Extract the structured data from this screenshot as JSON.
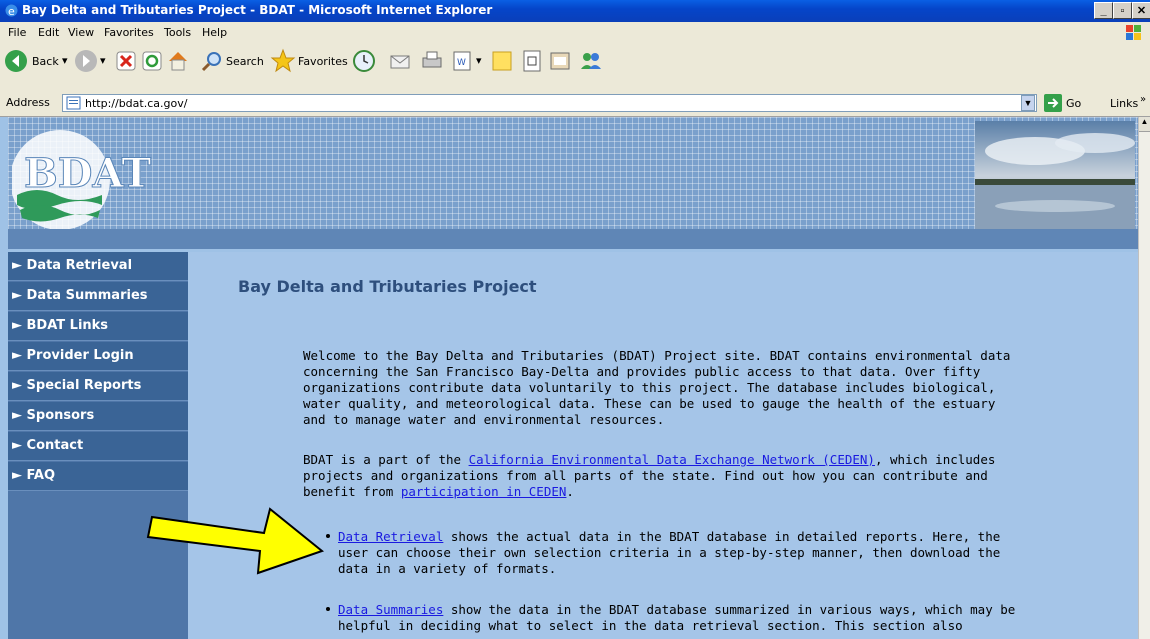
{
  "window": {
    "title": "Bay Delta and Tributaries Project - BDAT - Microsoft Internet Explorer"
  },
  "menu": [
    "File",
    "Edit",
    "View",
    "Favorites",
    "Tools",
    "Help"
  ],
  "toolbar": {
    "back_label": "Back",
    "search_label": "Search",
    "favorites_label": "Favorites"
  },
  "address": {
    "label": "Address",
    "url": "http://bdat.ca.gov/",
    "go_label": "Go",
    "links_label": "Links"
  },
  "banner": {
    "logo_text": "BDAT"
  },
  "nav": [
    "► Data Retrieval",
    "► Data Summaries",
    "► BDAT Links",
    "► Provider Login",
    "► Special Reports",
    "► Sponsors",
    "► Contact",
    "► FAQ"
  ],
  "content": {
    "heading": "Bay Delta and Tributaries Project",
    "intro": "Welcome to the Bay Delta and Tributaries (BDAT) Project site.  BDAT contains environmental data concerning the San Francisco Bay-Delta and provides public access to that data.  Over fifty organizations contribute data voluntarily to this project.  The database includes biological, water quality, and meteorological data.  These can be used to gauge the health of the estuary and to manage water and environmental resources.",
    "p2_before": "BDAT is a part of the ",
    "p2_link": "California Environmental Data Exchange Network (CEDEN)",
    "p2_middle": ", which includes projects and organizations from all parts of the state.  Find out how you can contribute and benefit from ",
    "p2_link2": "participation in CEDEN",
    "p2_end": ".",
    "bullet1_link": "Data Retrieval",
    "bullet1_text": " shows the actual data in the BDAT database in detailed reports.  Here, the user can choose their own selection criteria in a step-by-step manner, then download the data in a variety of formats.",
    "bullet2_link": "Data Summaries",
    "bullet2_text": " show the data in the BDAT database summarized in various ways, which may be helpful in deciding what to select in the data retrieval section.  This section also"
  },
  "colors": {
    "arrow": "#ffff00",
    "nav_bg": "#3a6496",
    "content_bg": "#a5c5e8"
  }
}
